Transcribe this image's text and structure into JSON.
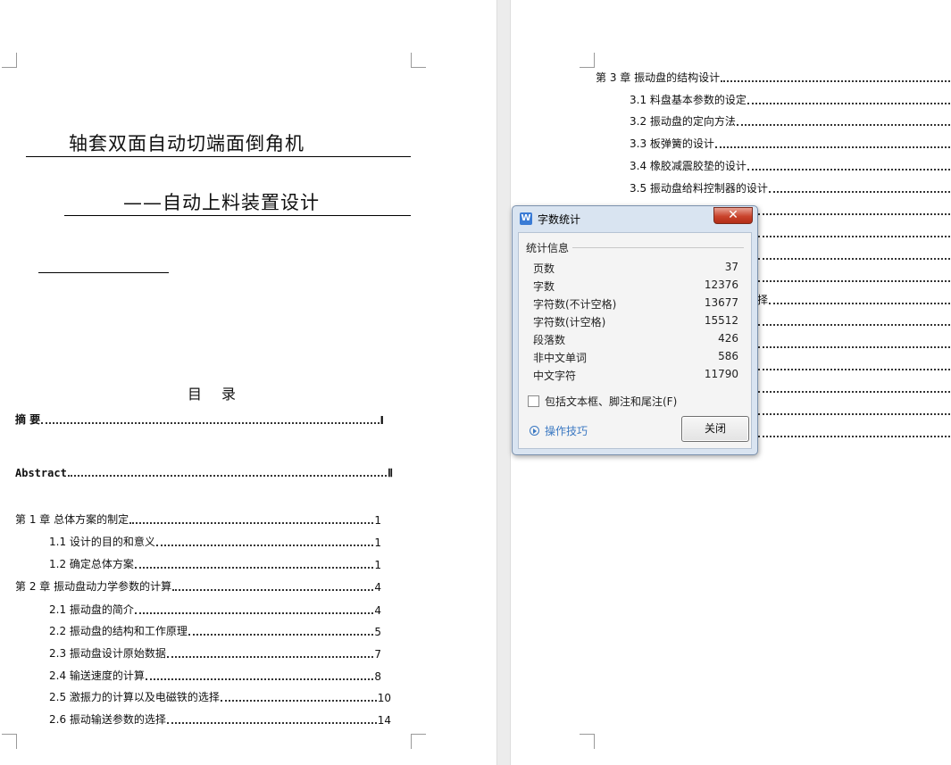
{
  "left_page": {
    "title_line1": "轴套双面自动切端面倒角机",
    "title_line2": "——自动上料装置设计",
    "toc_heading": "目录",
    "toc": [
      {
        "label": "摘  要",
        "page": "Ⅰ"
      },
      {
        "label": "Abstract",
        "page": "Ⅱ"
      },
      {
        "label": "第 1 章  总体方案的制定",
        "page": "1"
      },
      {
        "label": "1.1 设计的目的和意义",
        "page": "1"
      },
      {
        "label": "1.2 确定总体方案",
        "page": "1"
      },
      {
        "label": "第 2 章  振动盘动力学参数的计算",
        "page": "4"
      },
      {
        "label": "2.1 振动盘的简介",
        "page": "4"
      },
      {
        "label": "2.2 振动盘的结构和工作原理",
        "page": "5"
      },
      {
        "label": "2.3 振动盘设计原始数据",
        "page": "7"
      },
      {
        "label": "2.4 输送速度的计算",
        "page": "8"
      },
      {
        "label": "2.5 激振力的计算以及电磁铁的选择",
        "page": "10"
      },
      {
        "label": "2.6 振动输送参数的选择",
        "page": "14"
      }
    ]
  },
  "right_page": {
    "toc": [
      {
        "label": "第 3 章  振动盘的结构设计"
      },
      {
        "label": "3.1 料盘基本参数的设定"
      },
      {
        "label": "3.2 振动盘的定向方法"
      },
      {
        "label": "3.3 板弹簧的设计"
      },
      {
        "label": "3.4 橡胶减震胶垫的设计"
      },
      {
        "label": "3.5 振动盘给料控制器的设计"
      }
    ],
    "partial_text": "择"
  },
  "dialog": {
    "title": "字数统计",
    "app_icon": "W",
    "close_glyph": "✕",
    "group_title": "统计信息",
    "stats": [
      {
        "key": "页数",
        "value": "37"
      },
      {
        "key": "字数",
        "value": "12376"
      },
      {
        "key": "字符数(不计空格)",
        "value": "13677"
      },
      {
        "key": "字符数(计空格)",
        "value": "15512"
      },
      {
        "key": "段落数",
        "value": "426"
      },
      {
        "key": "非中文单词",
        "value": "586"
      },
      {
        "key": "中文字符",
        "value": "11790"
      }
    ],
    "checkbox_label": "包括文本框、脚注和尾注(F)",
    "tips_label": "操作技巧",
    "close_button": "关闭"
  }
}
